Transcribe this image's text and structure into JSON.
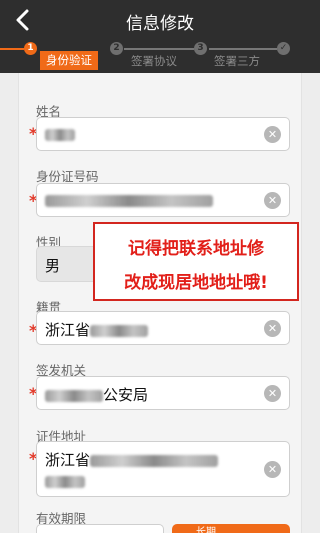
{
  "header": {
    "title": "信息修改"
  },
  "steps": [
    {
      "number": "1",
      "label": "身份验证"
    },
    {
      "number": "2",
      "label": "签署协议"
    },
    {
      "number": "3",
      "label": "签署三方"
    },
    {
      "number": "✓"
    }
  ],
  "form": {
    "name_label": "姓名",
    "idno_label": "身份证号码",
    "gender_label": "性别",
    "gender_value": "男",
    "origin_label": "籍贯",
    "origin_value": "浙江省",
    "authority_label": "签发机关",
    "authority_value": "公安局",
    "address_label": "证件地址",
    "address_value": "浙江省",
    "validity_label": "有效期限",
    "required_mark": "*"
  },
  "callout": {
    "line1": "记得把联系地址修",
    "line2": "改成现居地地址哦!"
  },
  "toggle": {
    "text": "长期"
  },
  "colors": {
    "accent": "#f06a18",
    "header_bg": "#2e2e2e",
    "callout_red": "#e21f19"
  }
}
